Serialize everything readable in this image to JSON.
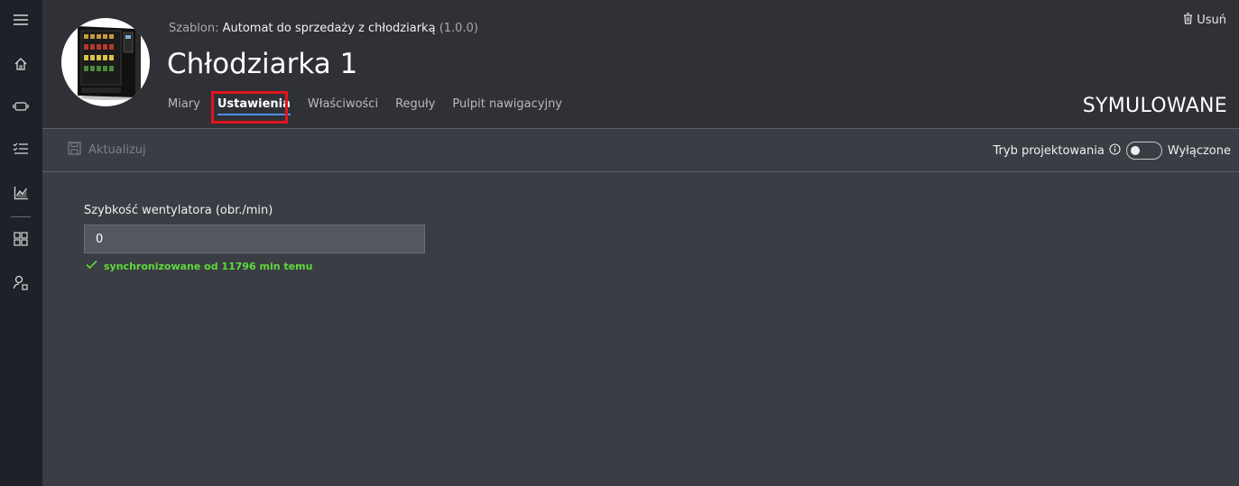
{
  "header": {
    "template_prefix": "Szablon:",
    "template_name": "Automat do sprzedaży z chłodziarką",
    "template_version": "(1.0.0)",
    "title": "Chłodziarka 1",
    "delete_label": "Usuń",
    "status": "SYMULOWANE",
    "tabs": [
      {
        "label": "Miary"
      },
      {
        "label": "Ustawienia"
      },
      {
        "label": "Właściwości"
      },
      {
        "label": "Reguły"
      },
      {
        "label": "Pulpit nawigacyjny"
      }
    ]
  },
  "sidebar": {
    "icons": [
      "hamburger-menu-icon",
      "home-icon",
      "device-icon",
      "checklist-icon",
      "analytics-icon",
      "dashboard-grid-icon",
      "user-settings-icon"
    ]
  },
  "toolbar": {
    "update_label": "Aktualizuj",
    "design_mode_label": "Tryb projektowania",
    "design_mode_state": "Wyłączone"
  },
  "form": {
    "field_label": "Szybkość wentylatora (obr./min)",
    "field_value": "0",
    "sync_status": "synchronizowane od 11796 min temu"
  },
  "colors": {
    "sidebar_bg": "#1f2128",
    "header_bg": "#2f3137",
    "content_bg": "#3b3d44",
    "accent": "#4f8ff0",
    "highlight": "#e0141e",
    "success": "#5ddb3a"
  }
}
